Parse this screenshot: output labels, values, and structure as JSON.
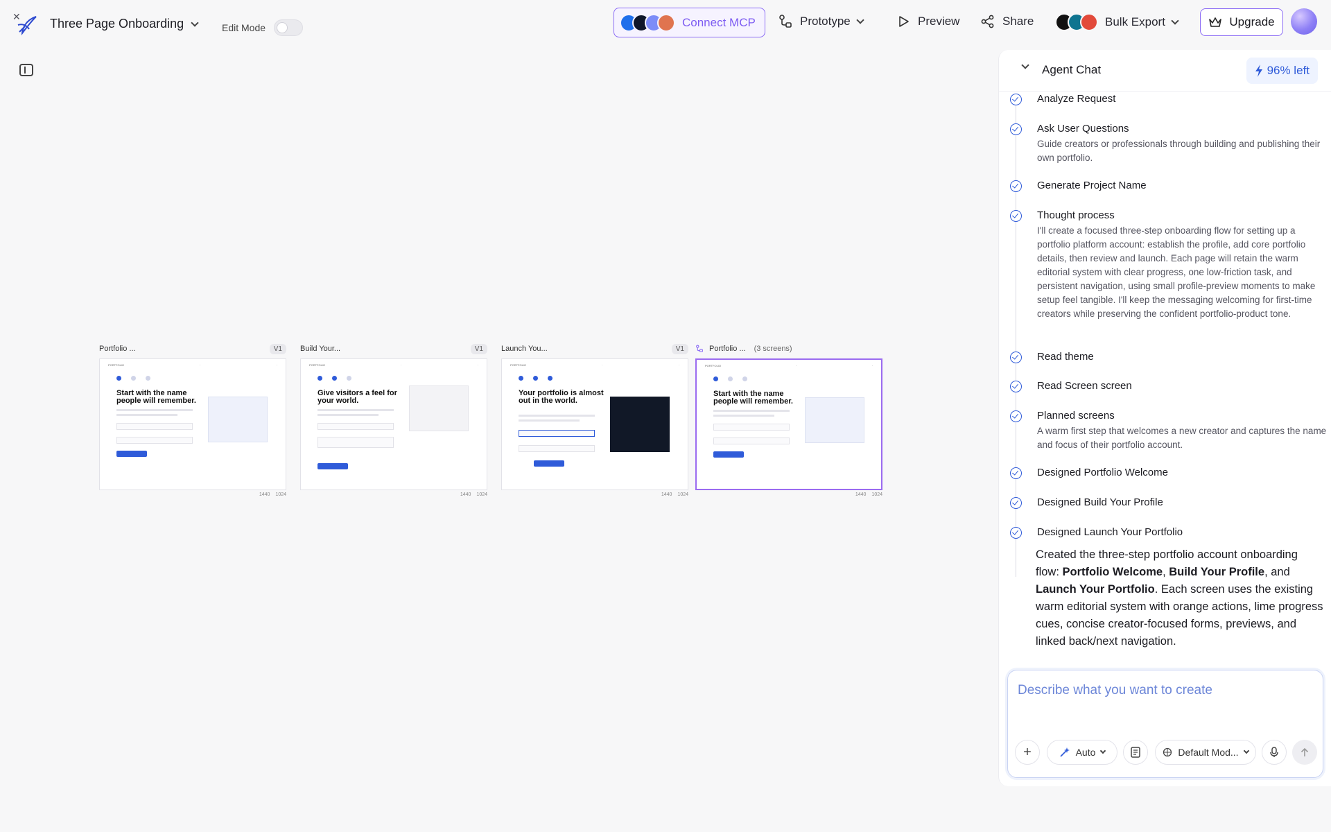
{
  "header": {
    "project_title": "Three Page Onboarding",
    "edit_mode_label": "Edit Mode",
    "connect_mcp_label": "Connect MCP",
    "prototype_label": "Prototype",
    "preview_label": "Preview",
    "share_label": "Share",
    "bulk_export_label": "Bulk Export",
    "upgrade_label": "Upgrade"
  },
  "colors": {
    "accent": "#2f5bd9",
    "purple": "#8b6bf5",
    "mcp_avatars": [
      "#1f6feb",
      "#0f172a",
      "#7c8cf8",
      "#e0744f"
    ],
    "export_avatars": [
      "#111111",
      "#0e7490",
      "#e24a3b"
    ]
  },
  "frames": [
    {
      "name": "Portfolio ...",
      "version": "V1",
      "heading": "Start with the name people will remember.",
      "dims": [
        "1440",
        "1024"
      ],
      "active": false,
      "screens_label": ""
    },
    {
      "name": "Build Your...",
      "version": "V1",
      "heading": "Give visitors a feel for your world.",
      "dims": [
        "1440",
        "1024"
      ],
      "active": false,
      "screens_label": ""
    },
    {
      "name": "Launch You...",
      "version": "V1",
      "heading": "Your portfolio is almost out in the world.",
      "dims": [
        "1440",
        "1024"
      ],
      "active": false,
      "screens_label": ""
    },
    {
      "name": "Portfolio ...",
      "version": "",
      "heading": "Start with the name people will remember.",
      "dims": [
        "1440",
        "1024"
      ],
      "active": true,
      "screens_label": "(3 screens)"
    }
  ],
  "chat": {
    "title": "Agent Chat",
    "credits": "96% left",
    "steps": [
      {
        "title": "Analyze Request",
        "desc": ""
      },
      {
        "title": "Ask User Questions",
        "desc": "Guide creators or professionals through building and publishing their own portfolio."
      },
      {
        "title": "Generate Project Name",
        "desc": ""
      },
      {
        "title": "Thought process",
        "desc": "I'll create a focused three-step onboarding flow for setting up a portfolio platform account: establish the profile, add core portfolio details, then review and launch. Each page will retain the warm editorial system with clear progress, one low-friction task, and persistent navigation, using small profile-preview moments to make setup feel tangible. I'll keep the messaging welcoming for first-time creators while preserving the confident portfolio-product tone."
      },
      {
        "title": "Read theme",
        "desc": ""
      },
      {
        "title": "Read Screen screen",
        "desc": ""
      },
      {
        "title": "Planned screens",
        "desc": "A warm first step that welcomes a new creator and captures the name and focus of their portfolio account."
      },
      {
        "title": "Designed Portfolio Welcome",
        "desc": ""
      },
      {
        "title": "Designed Build Your Profile",
        "desc": ""
      },
      {
        "title": "Designed Launch Your Portfolio",
        "desc": ""
      }
    ],
    "summary": {
      "intro": "Created the three-step portfolio account onboarding flow: ",
      "screen_1": "Portfolio Welcome",
      "sep_1": ", ",
      "screen_2": "Build Your Profile",
      "sep_2": ", and ",
      "screen_3": "Launch Your Portfolio",
      "outro": ". Each screen uses the existing warm editorial system with orange actions, lime progress cues, concise creator-focused forms, previews, and linked back/next navigation."
    },
    "composer": {
      "placeholder": "Describe what you want to create",
      "mode_label": "Auto",
      "model_label": "Default Mod..."
    }
  }
}
